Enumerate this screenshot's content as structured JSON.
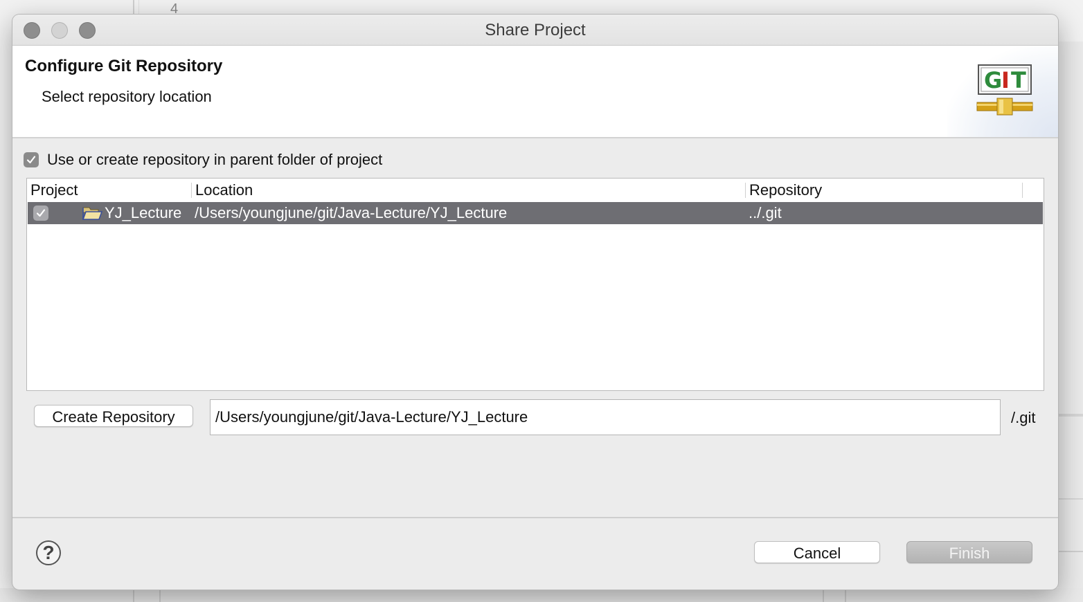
{
  "background": {
    "line_number": "4"
  },
  "window": {
    "title": "Share Project"
  },
  "header": {
    "title": "Configure Git Repository",
    "subtitle": "Select repository location",
    "logo_text": "GIT",
    "logo_icon": "git-pipe-icon"
  },
  "parent_folder_option": {
    "label": "Use or create repository in parent folder of project",
    "checked": true
  },
  "table": {
    "columns": [
      "Project",
      "Location",
      "Repository"
    ],
    "rows": [
      {
        "checked": true,
        "icon": "folder-open-icon",
        "project": "YJ_Lecture",
        "location": "/Users/youngjune/git/Java-Lecture/YJ_Lecture",
        "repository": "../.git",
        "selected": true
      }
    ]
  },
  "create": {
    "button_label": "Create Repository",
    "path_value": "/Users/youngjune/git/Java-Lecture/YJ_Lecture",
    "suffix": "/.git"
  },
  "footer": {
    "help_icon": "help-icon",
    "help_label": "?",
    "cancel_label": "Cancel",
    "finish_label": "Finish",
    "finish_enabled": false
  },
  "colors": {
    "selected_row": "#6e6e73",
    "logo_green": "#2e8b3c",
    "logo_red": "#c8281e",
    "logo_gold": "#d4a017"
  }
}
